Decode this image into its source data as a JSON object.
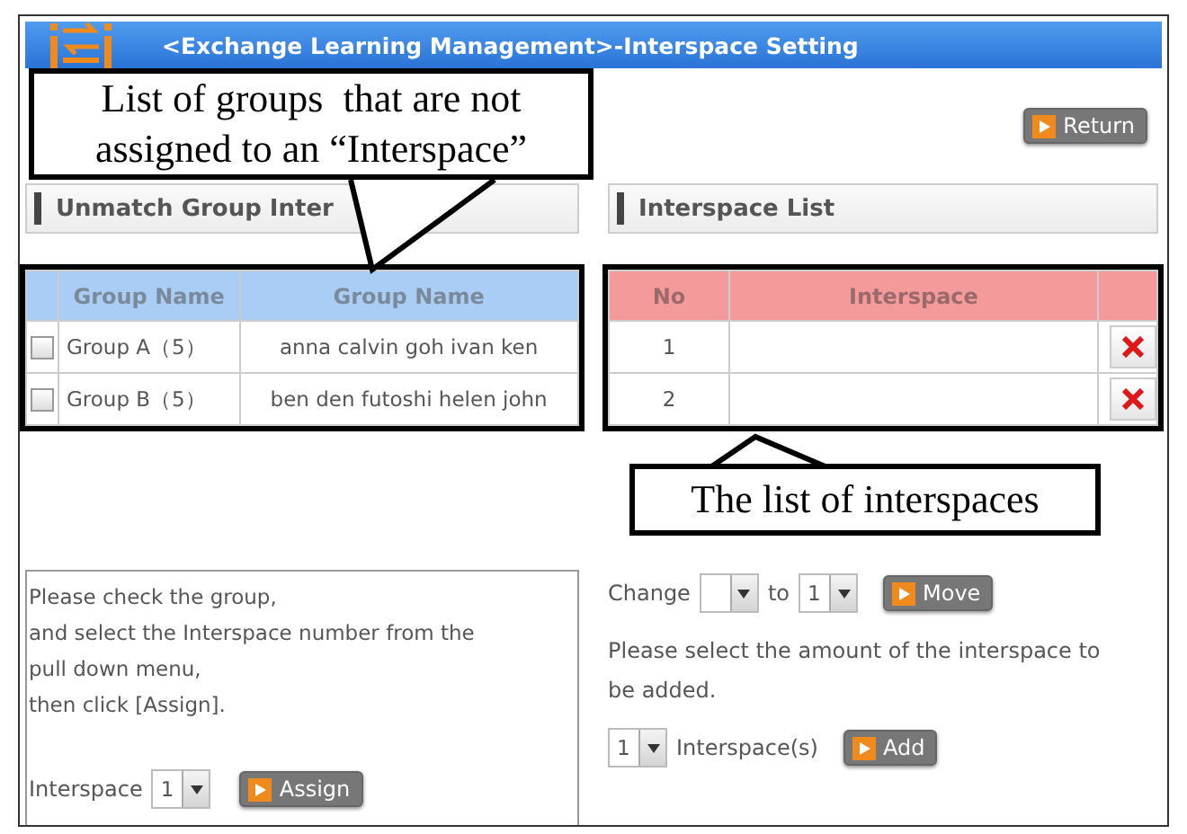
{
  "window": {
    "title": "<Exchange Learning Management>-Interspace Setting"
  },
  "return_button": "Return",
  "unmatched_panel": {
    "title": "Unmatch Group Inter",
    "columns": [
      "Group Name",
      "Group Name"
    ],
    "rows": [
      {
        "checked": false,
        "group": "Group A（5）",
        "members": "anna calvin goh ivan ken"
      },
      {
        "checked": false,
        "group": "Group B（5）",
        "members": "ben den futoshi helen john"
      }
    ]
  },
  "interspace_panel": {
    "title": "Interspace List",
    "columns": [
      "No",
      "Interspace"
    ],
    "rows": [
      {
        "no": "1"
      },
      {
        "no": "2"
      }
    ]
  },
  "assign_panel": {
    "instructions": "Please check the group,\nand select the Interspace number from the\npull down menu,\nthen click [Assign].",
    "label": "Interspace",
    "value": "1",
    "button": "Assign"
  },
  "move_panel": {
    "label": "Change",
    "to_label": "to",
    "to_value": "1",
    "button": "Move"
  },
  "add_panel": {
    "instructions": "Please select the amount of the interspace to\nbe added.",
    "count": "1",
    "unit": "Interspace(s)",
    "button": "Add"
  },
  "annotations": [
    {
      "text": "List of groups  that are not\nassigned to an “Interspace”"
    },
    {
      "text": "The list of interspaces"
    }
  ]
}
